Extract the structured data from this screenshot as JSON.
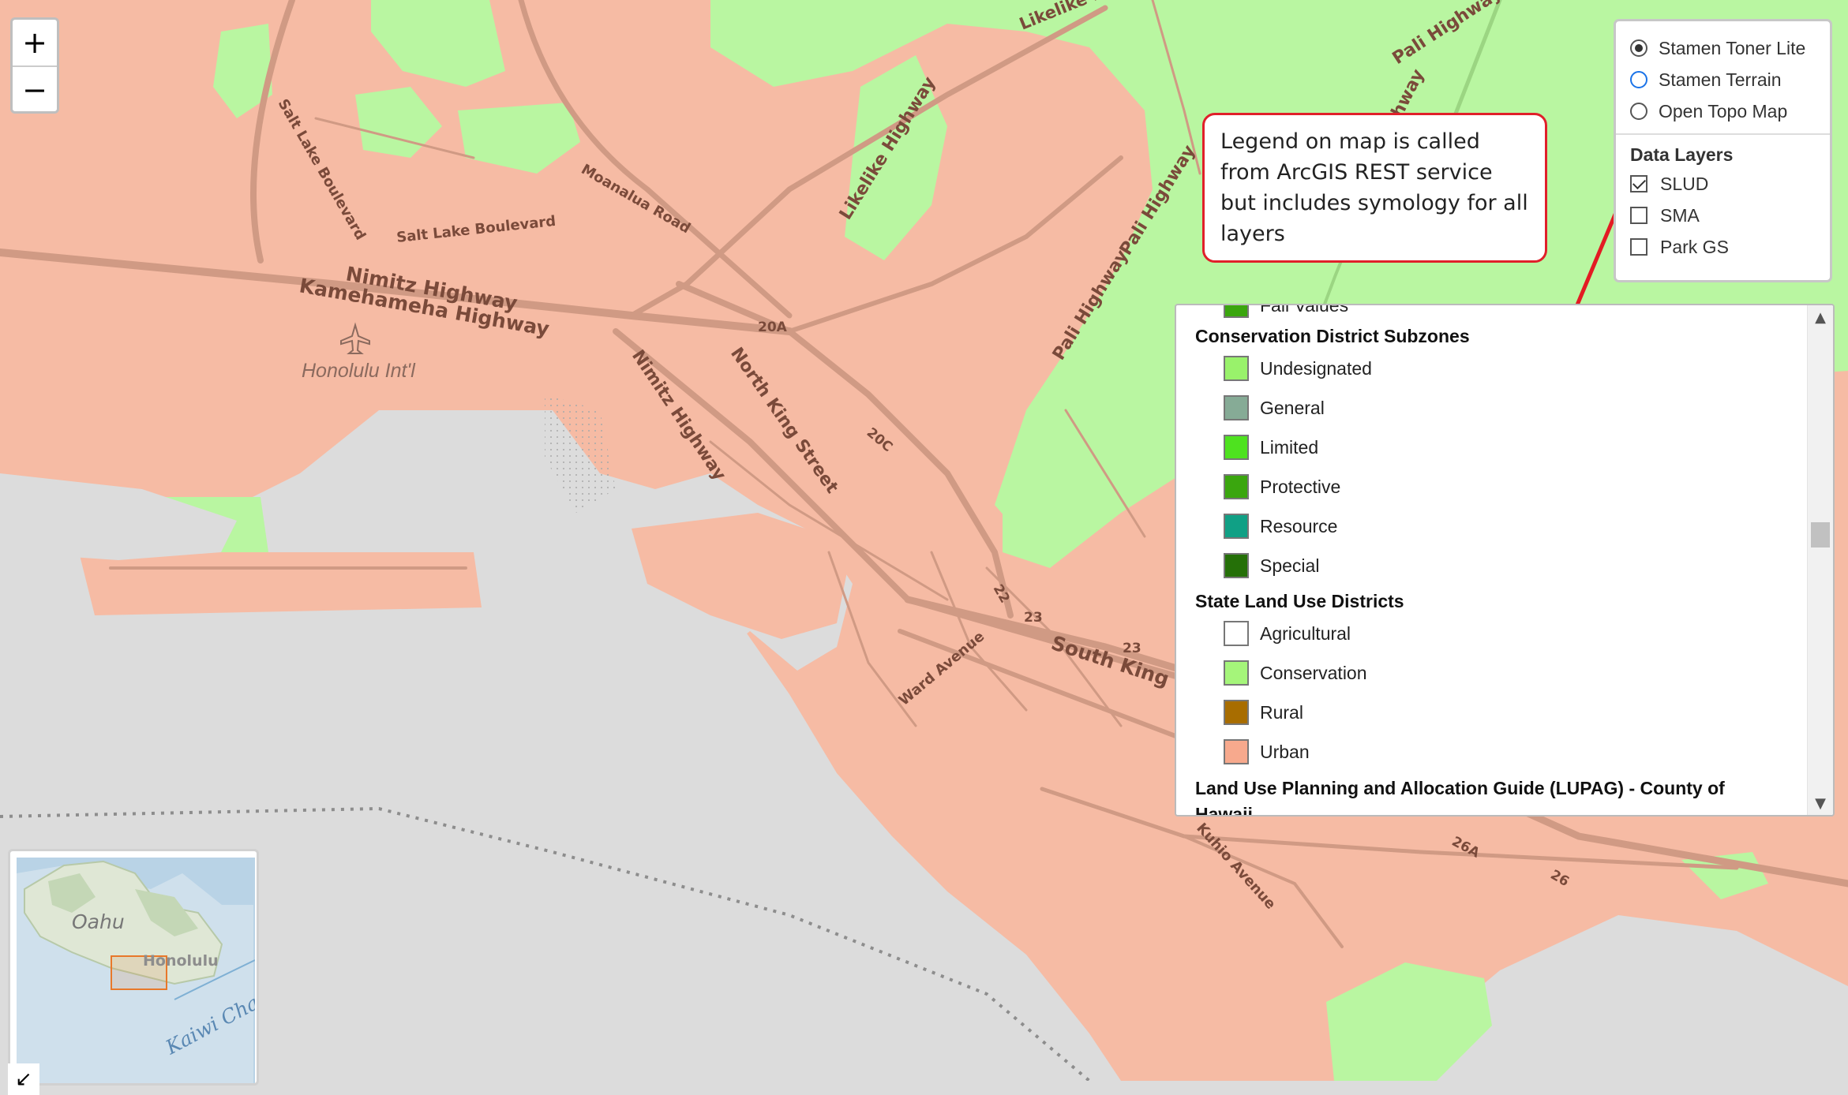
{
  "map": {
    "labels": {
      "likelike_top": "Likelike Hig",
      "pali_top": "Pali Highway",
      "salt_lake_vertical": "Salt Lake Boulevard",
      "salt_lake_horizontal": "Salt Lake Boulevard",
      "moanalua": "Moanalua Road",
      "likelike": "Likelike Highway",
      "pali_mid": "Pali Highway",
      "pali_low": "Pali Highway",
      "nimitz": "Nimitz Highway",
      "kamehameha": "Kamehameha Highway",
      "airport": "Honolulu Int'l",
      "nimitz_south": "Nimitz Highway",
      "north_king": "North King Street",
      "r20a": "20A",
      "r20c": "20C",
      "r22": "22",
      "r23a": "23",
      "r23b": "23",
      "south_king": "South King Stre",
      "ward": "Ward Avenue",
      "kuhio": "Kuhio Avenue",
      "r26a": "26A",
      "r26": "26",
      "hwy_partial": "hway"
    },
    "colors": {
      "urban": "#f6bba4",
      "conservation": "#b9f6a1",
      "water": "#dcdcdc",
      "road": "#d39c86"
    }
  },
  "zoom": {
    "in": "+",
    "out": "−"
  },
  "layers": {
    "basemaps": [
      {
        "label": "Stamen Toner Lite",
        "selected": true
      },
      {
        "label": "Stamen Terrain",
        "selected": false
      },
      {
        "label": "Open Topo Map",
        "selected": false
      }
    ],
    "data_title": "Data Layers",
    "data_layers": [
      {
        "label": "SLUD",
        "checked": true
      },
      {
        "label": "SMA",
        "checked": false
      },
      {
        "label": "Park GS",
        "checked": false
      }
    ]
  },
  "legend": {
    "partial_top": "Fall Values",
    "groups": [
      {
        "title": "Conservation District Subzones",
        "items": [
          {
            "label": "Undesignated",
            "color": "#99f26b"
          },
          {
            "label": "General",
            "color": "#86ab96"
          },
          {
            "label": "Limited",
            "color": "#4ee21f"
          },
          {
            "label": "Protective",
            "color": "#3aa60e"
          },
          {
            "label": "Resource",
            "color": "#10a085"
          },
          {
            "label": "Special",
            "color": "#257008"
          }
        ]
      },
      {
        "title": "State Land Use Districts",
        "items": [
          {
            "label": "Agricultural",
            "color": "#ffffff"
          },
          {
            "label": "Conservation",
            "color": "#a5f57a"
          },
          {
            "label": "Rural",
            "color": "#a86d00"
          },
          {
            "label": "Urban",
            "color": "#f7a98d"
          }
        ]
      },
      {
        "title": "Land Use Planning and Allocation Guide (LUPAG) - County of",
        "title_cont": "Hawaii",
        "items": []
      }
    ]
  },
  "callout": {
    "text": "Legend on map is called from ArcGIS REST service but includes symology for all layers",
    "border_color": "#e0202a"
  },
  "minimap": {
    "island": "Oahu",
    "city": "Honolulu",
    "channel": "Kaiwi Cha",
    "toggle": "↙"
  }
}
